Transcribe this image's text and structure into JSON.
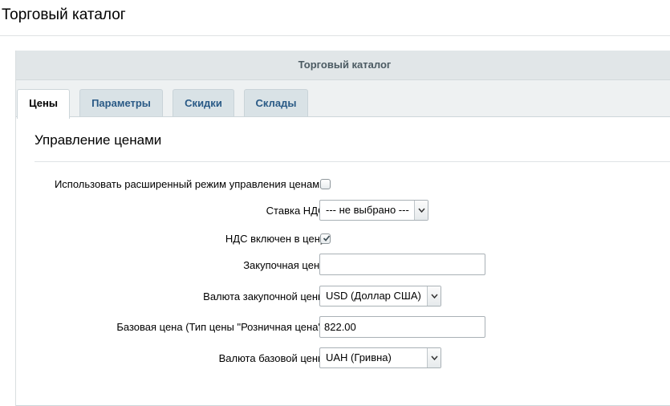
{
  "page": {
    "title": "Торговый каталог"
  },
  "panel": {
    "header": "Торговый каталог"
  },
  "tabs": [
    {
      "label": "Цены",
      "active": true
    },
    {
      "label": "Параметры",
      "active": false
    },
    {
      "label": "Скидки",
      "active": false
    },
    {
      "label": "Склады",
      "active": false
    }
  ],
  "section": {
    "title": "Управление ценами"
  },
  "form": {
    "extended_mode": {
      "label": "Использовать расширенный режим управления ценами:",
      "checked": false
    },
    "vat_rate": {
      "label": "Ставка НДС:",
      "selected": "--- не выбрано ---"
    },
    "vat_included": {
      "label": "НДС включен в цену:",
      "checked": true
    },
    "purchase_price": {
      "label": "Закупочная цена:",
      "value": ""
    },
    "purchase_currency": {
      "label": "Валюта закупочной цены:",
      "selected": "USD (Доллар США)"
    },
    "base_price": {
      "label": "Базовая цена (Тип цены \"Розничная цена\"):",
      "value": "822.00"
    },
    "base_currency": {
      "label": "Валюта базовой цены:",
      "selected": "UAH (Гривна)"
    }
  },
  "icons": {
    "checkbox_check": "checkmark-icon",
    "select_arrow": "chevron-down-icon"
  },
  "colors": {
    "tab_text": "#2a5a86",
    "panel_bg": "#eef1f2",
    "header_bg": "#e1e6e8"
  }
}
